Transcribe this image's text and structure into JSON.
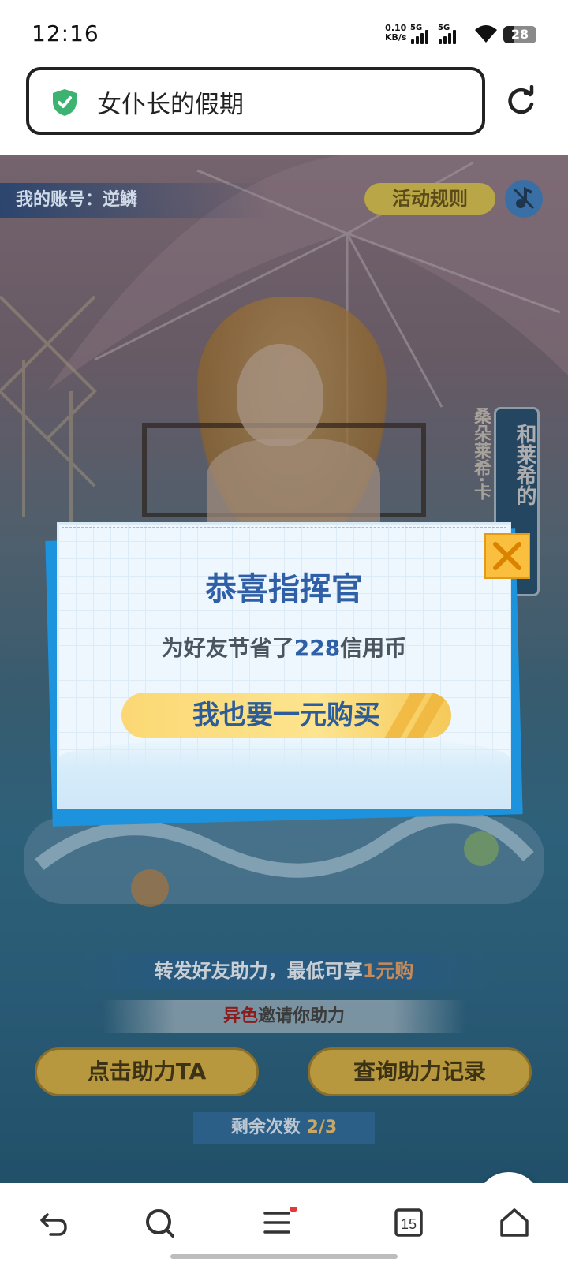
{
  "status_bar": {
    "time": "12:16",
    "net_speed_value": "0.10",
    "net_speed_unit": "KB/s",
    "sim1": "5G",
    "sim2": "5G",
    "battery": "28"
  },
  "browser": {
    "page_title": "女仆长的假期",
    "secure_icon": "shield-check-icon",
    "reload_icon": "reload-icon"
  },
  "page": {
    "account_label": "我的账号：逆鳞",
    "rules_button": "活动规则",
    "music_icon": "music-off-icon",
    "vertical_banner": "和莱希的",
    "vertical_sub": "桑朵莱希·卡",
    "slogan_prefix": "转发好友助力，最低可享",
    "slogan_highlight": "1元购",
    "inviter_name": "异色",
    "inviter_text": "邀请你助力",
    "help_button": "点击助力TA",
    "record_button": "查询助力记录",
    "remain_label": "剩余次数 ",
    "remain_value": "2/3",
    "download_icon": "download-float-icon"
  },
  "modal": {
    "title": "恭喜指挥官",
    "message_prefix": "为好友节省了",
    "message_amount": "228",
    "message_suffix": "信用币",
    "buy_button": "我也要一元购买",
    "close_icon": "close-icon"
  },
  "nav": {
    "back_icon": "back-icon",
    "search_icon": "search-icon",
    "menu_icon": "menu-icon",
    "tabs_count": "15",
    "home_icon": "home-icon"
  },
  "colors": {
    "accent_blue": "#2f5fa6",
    "button_yellow": "#fbd874",
    "close_orange": "#fbbf3f",
    "shield_green": "#3cb371",
    "notification_red": "#e53935"
  }
}
